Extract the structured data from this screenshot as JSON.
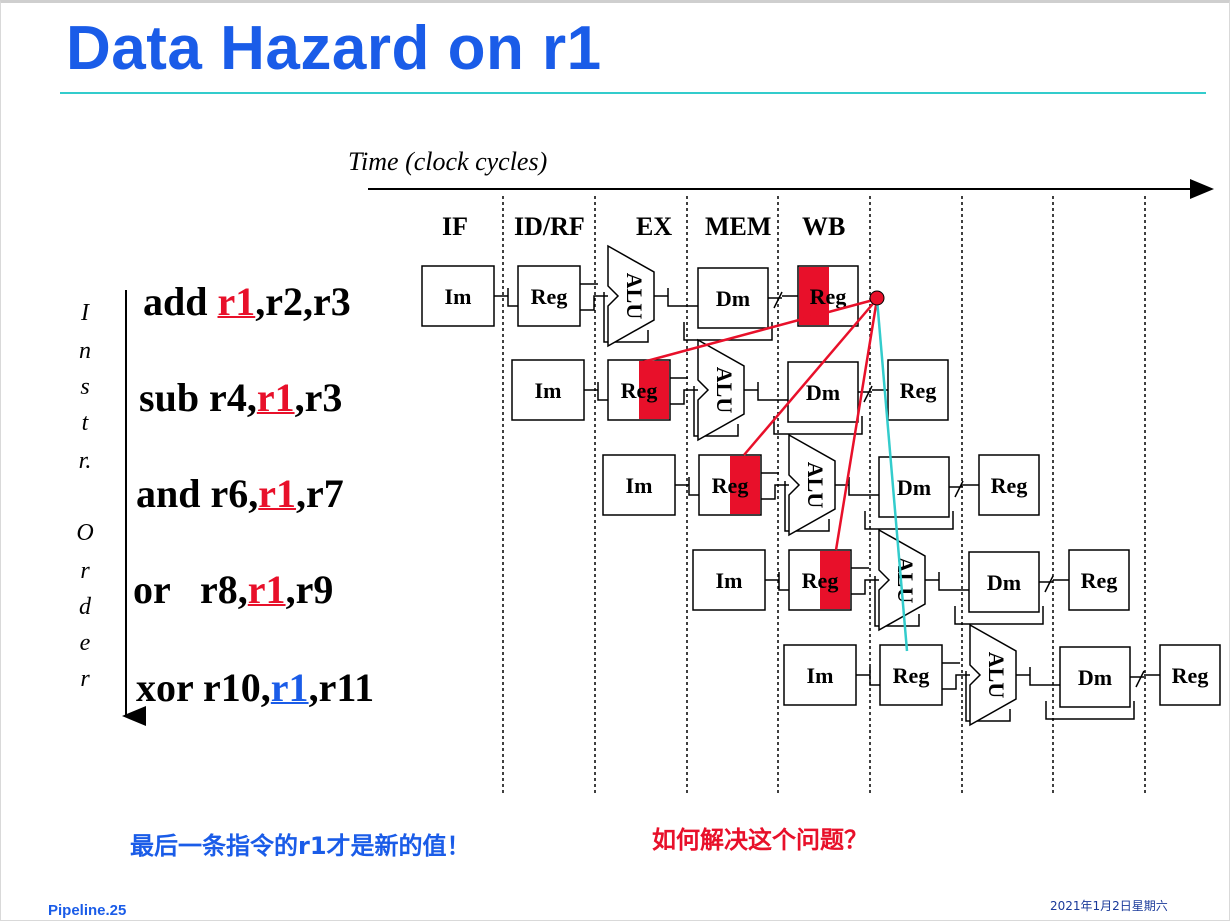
{
  "title": "Data Hazard on r1",
  "time_label": "Time (clock cycles)",
  "stages": [
    "IF",
    "ID/RF",
    "EX",
    "MEM",
    "WB"
  ],
  "order_letters": [
    "I",
    "n",
    "s",
    "t",
    "r.",
    "O",
    "r",
    "d",
    "e",
    "r"
  ],
  "instructions": [
    {
      "op": "add ",
      "pre": "",
      "reg": "r1",
      "post": ",r2,r3",
      "color": "red"
    },
    {
      "op": "sub r4,",
      "pre": "",
      "reg": "r1",
      "post": ",r3",
      "color": "red"
    },
    {
      "op": "and r6,",
      "pre": "",
      "reg": "r1",
      "post": ",r7",
      "color": "red"
    },
    {
      "op": "or   r8,",
      "pre": "",
      "reg": "r1",
      "post": ",r9",
      "color": "red"
    },
    {
      "op": "xor r10,",
      "pre": "",
      "reg": "r1",
      "post": ",r11",
      "color": "blue"
    }
  ],
  "unit_labels": {
    "im": "Im",
    "reg": "Reg",
    "alu": "ALU",
    "dm": "Dm"
  },
  "note_left": "最后一条指令的r1才是新的值！",
  "note_right": "如何解决这个问题？",
  "footer_left": "Pipeline.25",
  "footer_right": "2021年1月2日星期六",
  "colors": {
    "title": "#1a5ce8",
    "hazard_red": "#e8102a",
    "ok_blue": "#1a5ce8",
    "forward_line": "#33cccc",
    "rule": "#33cccc"
  }
}
